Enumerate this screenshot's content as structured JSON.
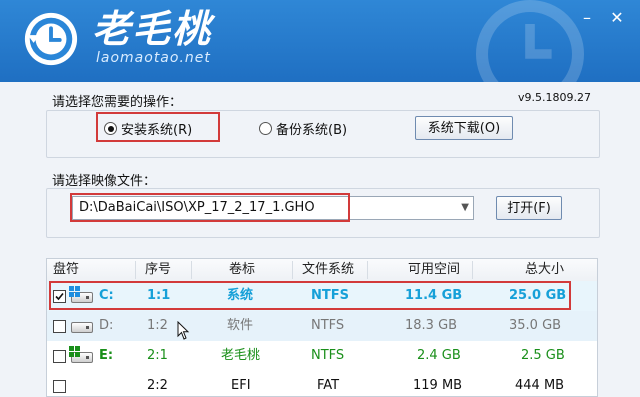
{
  "header": {
    "title": "老毛桃",
    "url": "laomaotao.net",
    "minimize_glyph": "–",
    "close_glyph": "✕"
  },
  "operation": {
    "prompt": "请选择您需要的操作：",
    "version": "v9.5.1809.27",
    "install_label": "安装系统(R)",
    "backup_label": "备份系统(B)",
    "download_label": "系统下载(O)",
    "selected": "install"
  },
  "image_file": {
    "prompt": "请选择映像文件：",
    "value": "D:\\DaBaiCai\\ISO\\XP_17_2_17_1.GHO",
    "open_label": "打开(F)"
  },
  "table": {
    "columns": [
      "盘符",
      "序号",
      "卷标",
      "文件系统",
      "可用空间",
      "总大小"
    ],
    "rows": [
      {
        "drive": "C:",
        "index": "1:1",
        "label": "系统",
        "fs": "NTFS",
        "free": "11.4 GB",
        "total": "25.0 GB",
        "checked": true,
        "style": "selected",
        "color": "#16a0d8"
      },
      {
        "drive": "D:",
        "index": "1:2",
        "label": "软件",
        "fs": "NTFS",
        "free": "18.3 GB",
        "total": "35.0 GB",
        "checked": false,
        "style": "normal",
        "color": "#777777"
      },
      {
        "drive": "E:",
        "index": "2:1",
        "label": "老毛桃",
        "fs": "NTFS",
        "free": "2.4 GB",
        "total": "2.5 GB",
        "checked": false,
        "style": "green",
        "color": "#1a8f1a"
      },
      {
        "drive": "",
        "index": "2:2",
        "label": "EFI",
        "fs": "FAT",
        "free": "119 MB",
        "total": "444 MB",
        "checked": false,
        "style": "normal",
        "color": "#111111"
      }
    ]
  },
  "colors": {
    "header_bg": "#2779cc",
    "highlight_red": "#d23a3a",
    "row_selected_bg": "#e6f4fb"
  }
}
